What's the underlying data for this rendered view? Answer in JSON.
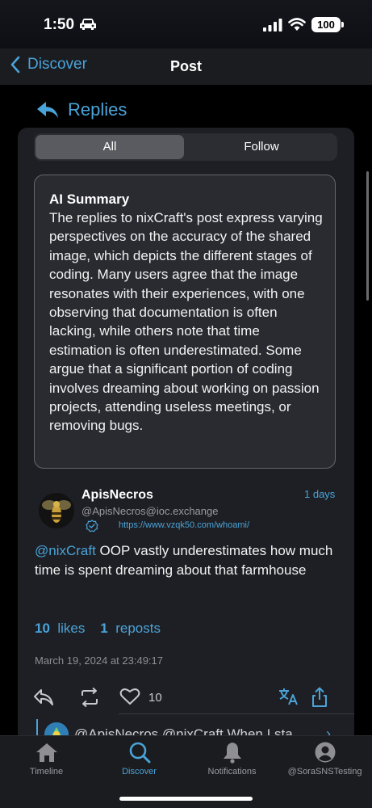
{
  "status_bar": {
    "time": "1:50",
    "battery": "100"
  },
  "nav": {
    "back_label": "Discover",
    "title": "Post"
  },
  "replies": {
    "header": "Replies",
    "segments": [
      "All",
      "Follow"
    ],
    "selected_segment": "All",
    "ai_summary": {
      "title": "AI Summary",
      "body": "The replies to nixCraft's post express varying perspectives on the accuracy of the shared image, which depicts the different stages of coding. Many users agree that the image resonates with their experiences, with one observing that documentation is often lacking, while others note that time estimation is often underestimated. Some argue that a significant portion of coding involves dreaming about working on passion projects, attending useless meetings, or removing bugs."
    }
  },
  "post": {
    "author_name": "ApisNecros",
    "author_handle": "@ApisNecros@ioc.exchange",
    "author_link": "https://www.vzqk50.com/whoami/",
    "time_ago": "1 days",
    "mention": "@nixCraft",
    "text": " OOP vastly underestimates how much time is spent dreaming about that farmhouse",
    "likes_count": "10",
    "likes_label": "likes",
    "reposts_count": "1",
    "reposts_label": "reposts",
    "date": "March 19, 2024 at 23:49:17",
    "like_action_count": "10"
  },
  "next_reply": {
    "preview": "@ApisNecros @nixCraft When I sta"
  },
  "tabs": [
    {
      "label": "Timeline",
      "icon": "home-icon",
      "active": false
    },
    {
      "label": "Discover",
      "icon": "search-icon",
      "active": true
    },
    {
      "label": "Notifications",
      "icon": "bell-icon",
      "active": false
    },
    {
      "label": "@SoraSNSTesting",
      "icon": "profile-icon",
      "active": false
    }
  ],
  "colors": {
    "accent": "#4aa3d8",
    "background": "#000000",
    "card": "#1e1f24"
  }
}
